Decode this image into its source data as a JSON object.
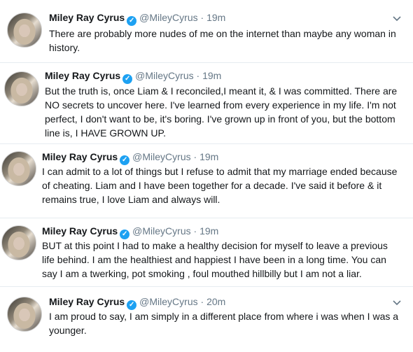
{
  "tweets": [
    {
      "name": "Miley Ray Cyrus",
      "handle": "@MileyCyrus",
      "separator": "·",
      "time": "19m",
      "text": "There are probably more nudes of me on the internet than maybe any woman in history."
    },
    {
      "name": "Miley Ray Cyrus",
      "handle": "@MileyCyrus",
      "separator": "·",
      "time": "19m",
      "text": "But the truth is, once Liam & I reconciled,I meant it, & I was committed. There are NO secrets to uncover here. I've learned from every experience in my life. I'm not perfect, I don't want to be, it's boring. I've grown up in front of you, but the bottom line is, I HAVE GROWN UP."
    },
    {
      "name": "Miley Ray Cyrus",
      "handle": "@MileyCyrus",
      "separator": "·",
      "time": "19m",
      "text": "I can admit to a lot of things but I refuse to admit that my marriage ended because of cheating. Liam and I have been together for a decade. I've said it before & it remains true, I love Liam and always will."
    },
    {
      "name": "Miley Ray Cyrus",
      "handle": "@MileyCyrus",
      "separator": "·",
      "time": "19m",
      "text": "BUT at this point I had to make a healthy decision for myself to leave a previous life behind. I am the healthiest and happiest I have been in a long time.  You can say I am a twerking, pot smoking , foul mouthed hillbilly but I am not a liar."
    },
    {
      "name": "Miley Ray Cyrus",
      "handle": "@MileyCyrus",
      "separator": "·",
      "time": "20m",
      "text": "I am proud to say, I am simply in a different place from where i was when I was a younger."
    }
  ],
  "icons": {
    "verified": "verified-badge-icon",
    "caret": "chevron-down-icon",
    "verified_color": "#1da1f2"
  }
}
